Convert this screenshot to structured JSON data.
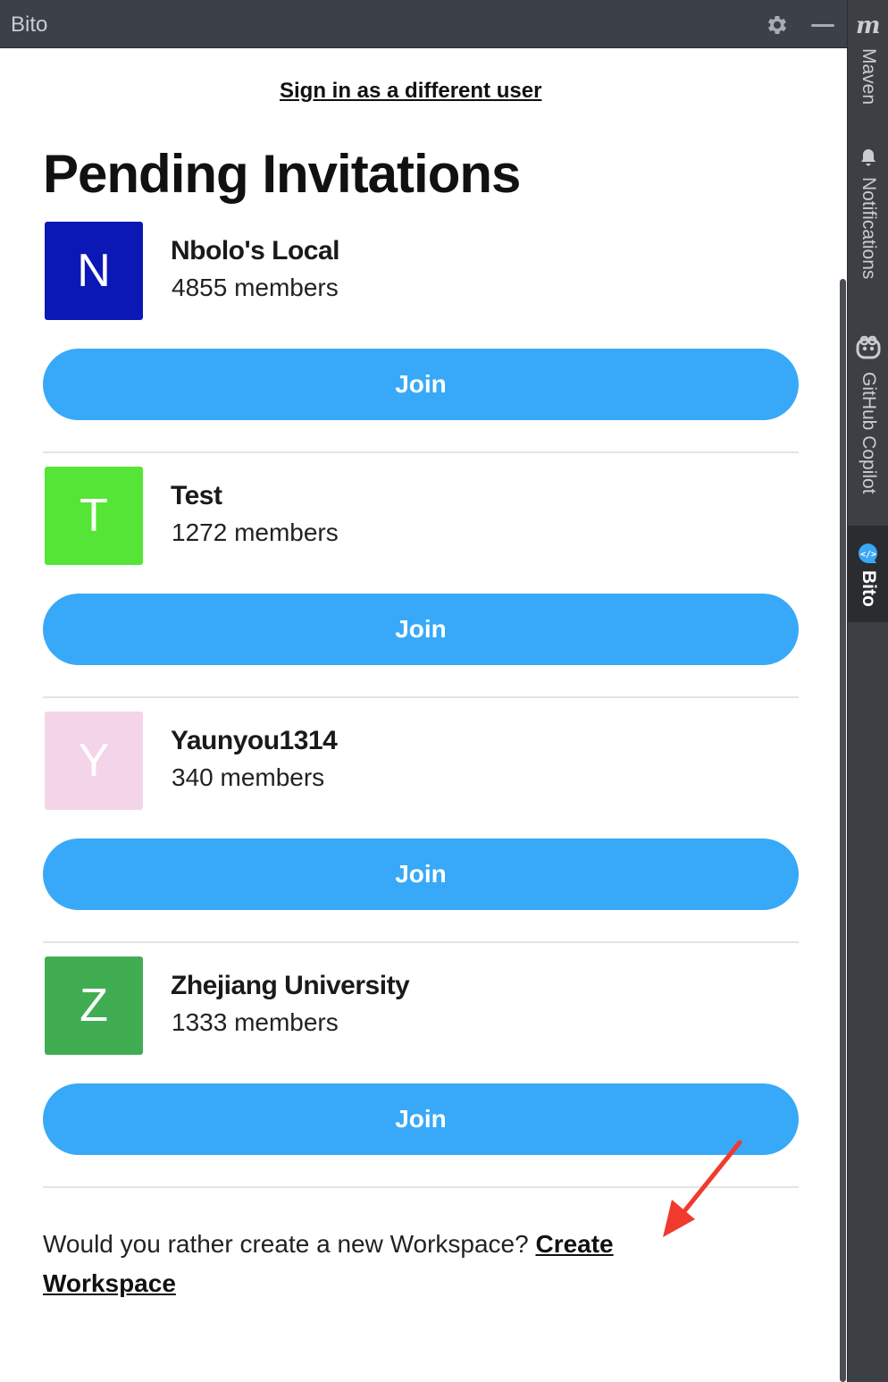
{
  "window": {
    "title": "Bito"
  },
  "toolstrip": {
    "items": [
      {
        "label": "Maven",
        "icon": "maven-icon"
      },
      {
        "label": "Notifications",
        "icon": "bell-icon"
      },
      {
        "label": "GitHub Copilot",
        "icon": "copilot-icon"
      },
      {
        "label": "Bito",
        "icon": "bito-icon",
        "active": true
      }
    ]
  },
  "content": {
    "sign_in_link": "Sign in as a different user",
    "heading": "Pending Invitations",
    "invitations": [
      {
        "initial": "N",
        "name": "Nbolo's Local",
        "members": "4855 members",
        "color": "#0c18b5",
        "join_label": "Join"
      },
      {
        "initial": "T",
        "name": "Test",
        "members": "1272 members",
        "color": "#55e536",
        "join_label": "Join"
      },
      {
        "initial": "Y",
        "name": "Yaunyou1314",
        "members": "340 members",
        "color": "#f4d4e8",
        "join_label": "Join"
      },
      {
        "initial": "Z",
        "name": "Zhejiang University",
        "members": "1333 members",
        "color": "#41ad53",
        "join_label": "Join"
      }
    ],
    "footer_text": "Would you rather create a new Workspace? ",
    "create_link": "Create Workspace"
  },
  "colors": {
    "accent": "#37a9f8",
    "annotation_arrow": "#f03a2e"
  }
}
